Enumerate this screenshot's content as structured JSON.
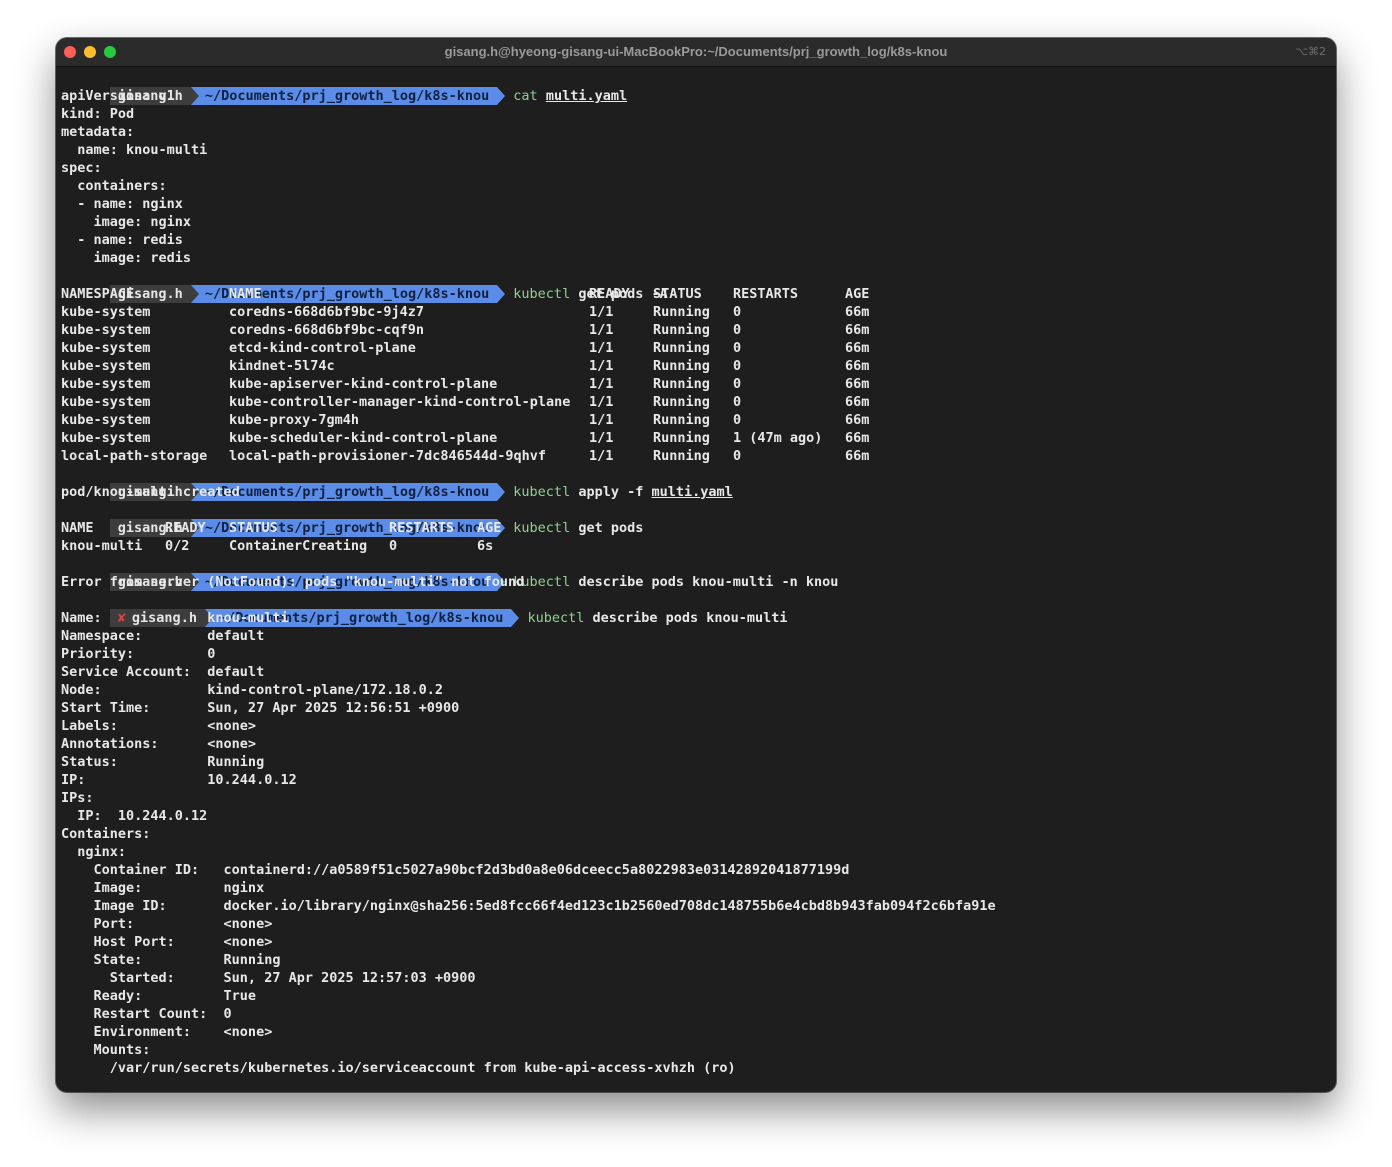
{
  "window": {
    "title": "gisang.h@hyeong-gisang-ui-MacBookPro:~/Documents/prj_growth_log/k8s-knou",
    "shortcut": "⌥⌘2"
  },
  "prompt": {
    "user": "gisang.h",
    "dir": "~/Documents/prj_growth_log/k8s-knou",
    "error_mark": "✘"
  },
  "cmd1": {
    "name": "cat",
    "file": "multi.yaml"
  },
  "yaml": [
    "apiVersion: v1",
    "kind: Pod",
    "metadata:",
    "  name: knou-multi",
    "spec:",
    "  containers:",
    "  - name: nginx",
    "    image: nginx",
    "  - name: redis",
    "    image: redis"
  ],
  "cmd2": {
    "name": "kubectl",
    "args": "get pods -A"
  },
  "pods_all": {
    "headers": [
      "NAMESPACE",
      "NAME",
      "READY",
      "STATUS",
      "RESTARTS",
      "AGE"
    ],
    "rows": [
      [
        "kube-system",
        "coredns-668d6bf9bc-9j4z7",
        "1/1",
        "Running",
        "0",
        "66m"
      ],
      [
        "kube-system",
        "coredns-668d6bf9bc-cqf9n",
        "1/1",
        "Running",
        "0",
        "66m"
      ],
      [
        "kube-system",
        "etcd-kind-control-plane",
        "1/1",
        "Running",
        "0",
        "66m"
      ],
      [
        "kube-system",
        "kindnet-5l74c",
        "1/1",
        "Running",
        "0",
        "66m"
      ],
      [
        "kube-system",
        "kube-apiserver-kind-control-plane",
        "1/1",
        "Running",
        "0",
        "66m"
      ],
      [
        "kube-system",
        "kube-controller-manager-kind-control-plane",
        "1/1",
        "Running",
        "0",
        "66m"
      ],
      [
        "kube-system",
        "kube-proxy-7gm4h",
        "1/1",
        "Running",
        "0",
        "66m"
      ],
      [
        "kube-system",
        "kube-scheduler-kind-control-plane",
        "1/1",
        "Running",
        "1 (47m ago)",
        "66m"
      ],
      [
        "local-path-storage",
        "local-path-provisioner-7dc846544d-9qhvf",
        "1/1",
        "Running",
        "0",
        "66m"
      ]
    ]
  },
  "cmd3": {
    "name": "kubectl",
    "args": "apply -f",
    "file": "multi.yaml"
  },
  "apply_out": "pod/knou-multi created",
  "cmd4": {
    "name": "kubectl",
    "args": "get pods"
  },
  "pods": {
    "headers": [
      "NAME",
      "READY",
      "STATUS",
      "RESTARTS",
      "AGE"
    ],
    "rows": [
      [
        "knou-multi",
        "0/2",
        "ContainerCreating",
        "0",
        "6s"
      ]
    ]
  },
  "cmd5": {
    "name": "kubectl",
    "args": "describe pods knou-multi -n knou"
  },
  "error_out": "Error from server (NotFound): pods \"knou-multi\" not found",
  "cmd6": {
    "name": "kubectl",
    "args": "describe pods knou-multi"
  },
  "describe": [
    "Name:             knou-multi",
    "Namespace:        default",
    "Priority:         0",
    "Service Account:  default",
    "Node:             kind-control-plane/172.18.0.2",
    "Start Time:       Sun, 27 Apr 2025 12:56:51 +0900",
    "Labels:           <none>",
    "Annotations:      <none>",
    "Status:           Running",
    "IP:               10.244.0.12",
    "IPs:",
    "  IP:  10.244.0.12",
    "Containers:",
    "  nginx:",
    "    Container ID:   containerd://a0589f51c5027a90bcf2d3bd0a8e06dceecc5a8022983e03142892041877199d",
    "    Image:          nginx",
    "    Image ID:       docker.io/library/nginx@sha256:5ed8fcc66f4ed123c1b2560ed708dc148755b6e4cbd8b943fab094f2c6bfa91e",
    "    Port:           <none>",
    "    Host Port:      <none>",
    "    State:          Running",
    "      Started:      Sun, 27 Apr 2025 12:57:03 +0900",
    "    Ready:          True",
    "    Restart Count:  0",
    "    Environment:    <none>",
    "    Mounts:",
    "      /var/run/secrets/kubernetes.io/serviceaccount from kube-api-access-xvhzh (ro)"
  ]
}
